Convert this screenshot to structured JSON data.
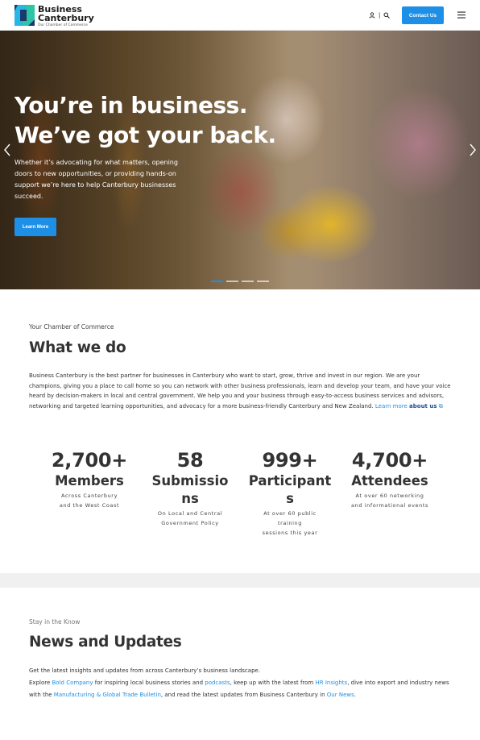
{
  "header": {
    "logo_line1": "Business",
    "logo_line2": "Canterbury",
    "logo_sub": "Our Chamber of Commerce",
    "separator": "|",
    "contact_label": "Contact Us"
  },
  "hero": {
    "title_line1": "You’re in business.",
    "title_line2": "We’ve got your back.",
    "body": "Whether it’s advocating for what matters, opening doors to new opportunities, or providing hands-on support we’re here to help Canterbury businesses succeed.",
    "button_label": "Learn More",
    "slides": 4,
    "active_slide": 1
  },
  "what_we_do": {
    "eyebrow": "Your Chamber of Commerce",
    "title": "What we do",
    "body": "Business Canterbury is the best partner for businesses in Canterbury who want to start, grow, thrive and invest in our region. We are your champions, giving you a place to call home so you can network with other business professionals, learn and develop your team, and have your voice heard by decision-makers in local and central government. We help you and your business through easy-to-access business services and advisors, networking and targeted learning opportunities, and advocacy for a more business-friendly Canterbury and New Zealand. ",
    "link_learn": "Learn more",
    "link_about": "about us",
    "link_suffix": "⧉"
  },
  "stats": [
    {
      "number": "2,700+",
      "label": "Members",
      "desc_lines": [
        "Across Canterbury",
        "and the West Coast"
      ]
    },
    {
      "number": "58",
      "label": "Submissions",
      "desc_lines": [
        "On Local and Central",
        "Government Policy"
      ]
    },
    {
      "number": "999+",
      "label": "Participants",
      "desc_lines": [
        "At over 60 public",
        "training",
        "sessions this year"
      ]
    },
    {
      "number": "4,700+",
      "label": "Attendees",
      "desc_lines": [
        "At over 60 networking",
        "and informational events"
      ]
    }
  ],
  "news": {
    "eyebrow": "Stay in the Know",
    "title": "News and Updates",
    "line1": "Get the latest insights and updates from across Canterbury’s business landscape.",
    "p2_a": "Explore ",
    "link_bold": "Bold Company",
    "p2_b": " for inspiring local business stories and ",
    "link_podcasts": "podcasts",
    "p2_c": ", keep up with the latest from ",
    "link_hr": "HR Insights",
    "p2_d": ", dive into export and industry news with the ",
    "link_mfg": "Manufacturing & Global Trade Bulletin",
    "p2_e": ", and read the latest updates from Business Canterbury in ",
    "link_news": "Our News",
    "p2_f": "."
  },
  "colors": {
    "accent": "#1d8fe6",
    "text": "#333333"
  }
}
